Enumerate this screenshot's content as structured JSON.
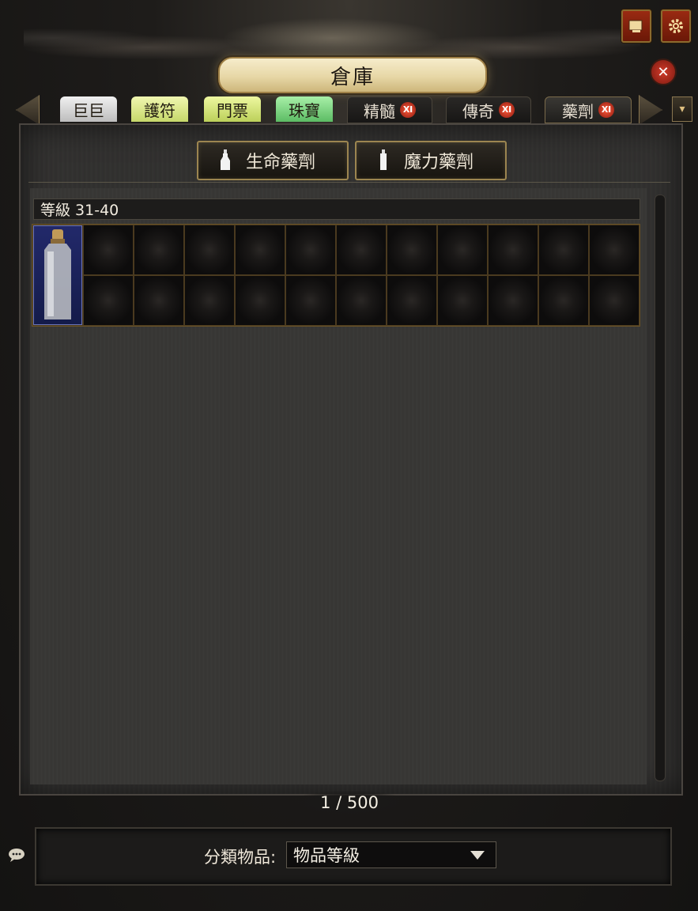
{
  "window": {
    "title": "倉庫"
  },
  "tabs": [
    {
      "label": "巨巨",
      "color": "#d8d8d8",
      "badge": false
    },
    {
      "label": "護符",
      "color": "#d8e88a",
      "badge": false
    },
    {
      "label": "門票",
      "color": "#d6e87c",
      "badge": false
    },
    {
      "label": "珠寶",
      "color": "#7edc84",
      "badge": false
    },
    {
      "label": "精髓",
      "badge": true,
      "badge_icon": "Ⅺ"
    },
    {
      "label": "傳奇",
      "badge": true,
      "badge_icon": "Ⅺ"
    },
    {
      "label": "藥劑",
      "badge": true,
      "badge_icon": "Ⅺ",
      "active": true
    }
  ],
  "subtabs": [
    {
      "label": "生命藥劑",
      "icon": "flask-icon"
    },
    {
      "label": "魔力藥劑",
      "icon": "flask-icon"
    }
  ],
  "level_group": {
    "label": "等級 31-40"
  },
  "grid": {
    "columns": 12,
    "rows": 2,
    "filled_slots": [
      0
    ]
  },
  "page_count": "1 / 500",
  "sort": {
    "label": "分類物品:",
    "value": "物品等級"
  },
  "icons": {
    "chat": "chat-bubble-icon",
    "map": "map-icon",
    "settings": "gear-icon",
    "close": "close-icon"
  }
}
